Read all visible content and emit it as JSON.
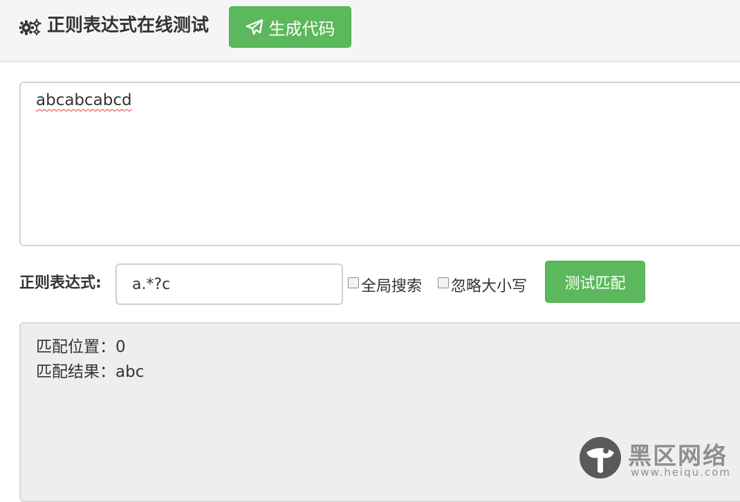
{
  "header": {
    "title": "正则表达式在线测试",
    "generate_button": "生成代码",
    "icons": {
      "title_icon": "gears-icon",
      "button_icon": "paper-plane-icon"
    }
  },
  "source_text": {
    "value": "abcabcabcd"
  },
  "regex": {
    "label": "正则表达式:",
    "value": "a.*?c",
    "options": [
      {
        "label": "全局搜索",
        "checked": false
      },
      {
        "label": "忽略大小写",
        "checked": false
      }
    ],
    "test_button": "测试匹配"
  },
  "result": {
    "position_line": "匹配位置：0",
    "result_line": "匹配结果：abc"
  },
  "watermark": {
    "name": "黑区网络",
    "url": "www.heiqu.com"
  },
  "colors": {
    "button_green": "#5cb85c",
    "header_bg": "#f5f5f5",
    "result_bg": "#eeeeee",
    "text": "#333333"
  }
}
